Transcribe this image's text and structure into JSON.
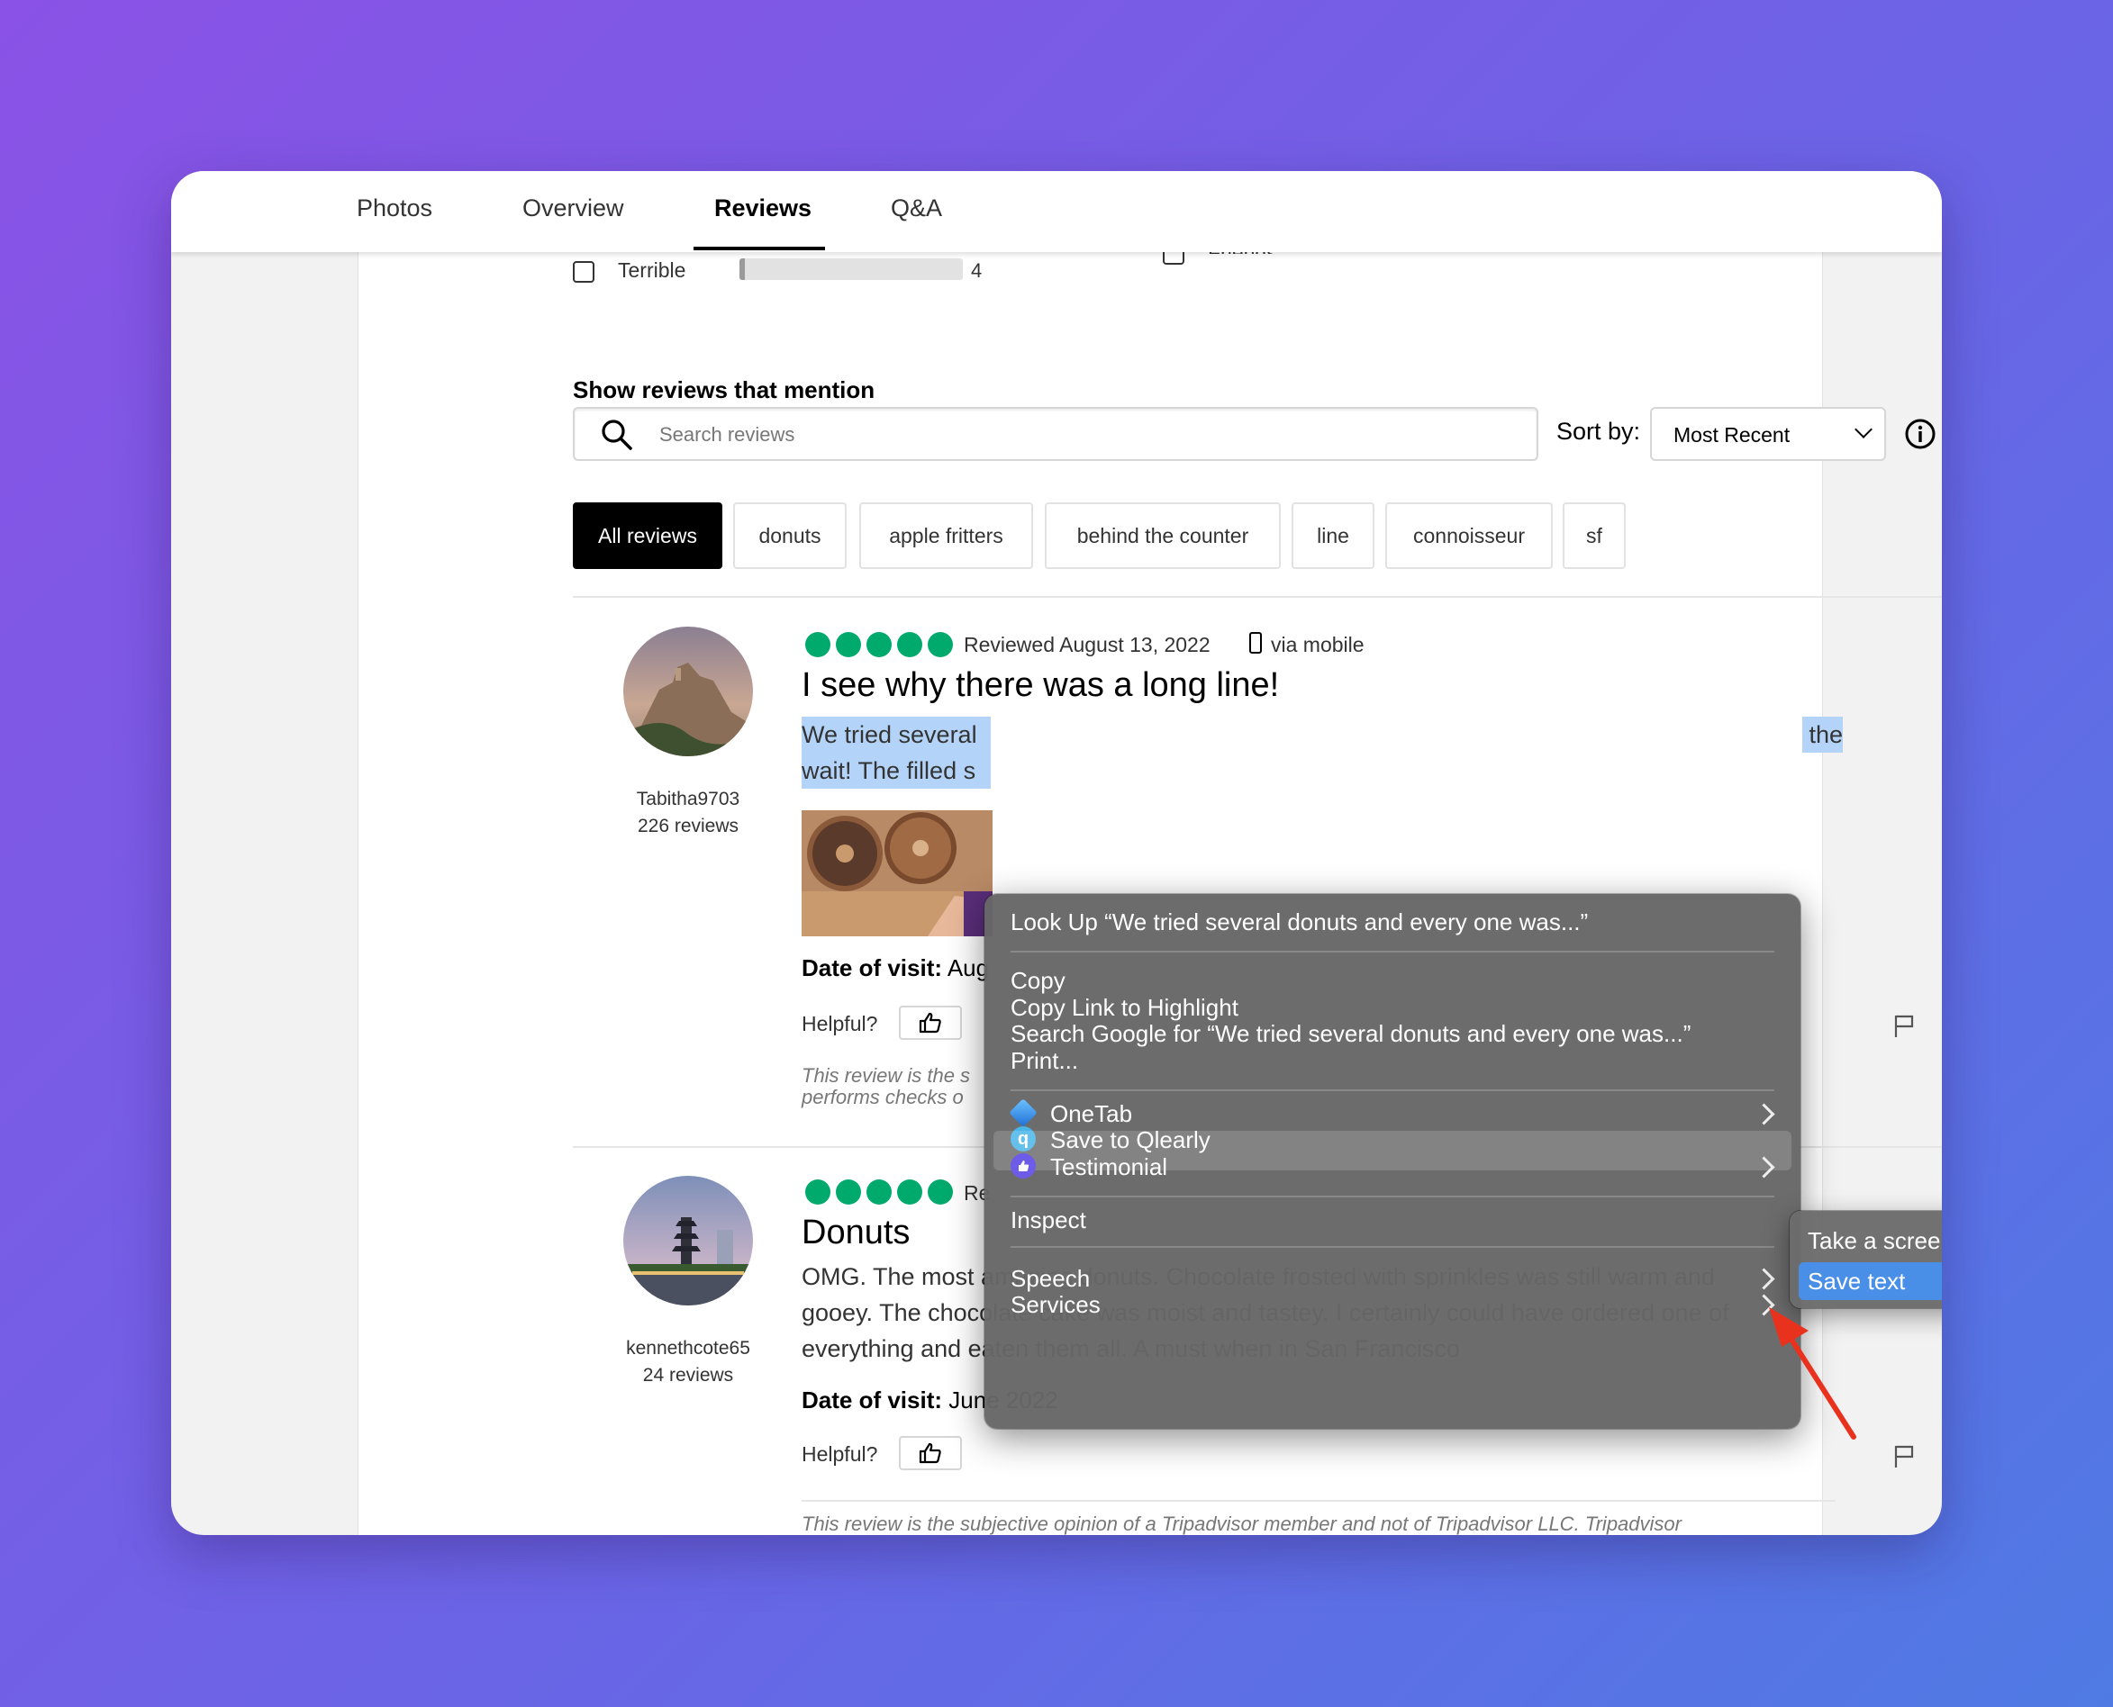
{
  "tabs": [
    "Photos",
    "Overview",
    "Reviews",
    "Q&A"
  ],
  "active_tab": "Reviews",
  "rating_filter": {
    "label": "Terrible",
    "count": "4",
    "partial_label": "Friends"
  },
  "mention": {
    "title": "Show reviews that mention",
    "search_placeholder": "Search reviews",
    "sort_label": "Sort by:",
    "sort_value": "Most Recent"
  },
  "chips": [
    "All reviews",
    "donuts",
    "apple fritters",
    "behind the counter",
    "line",
    "connoisseur",
    "sf"
  ],
  "reviews": [
    {
      "user": "Tabitha9703",
      "user_reviews": "226 reviews",
      "rating": 5,
      "date": "Reviewed August 13, 2022",
      "device": "via mobile",
      "title": "I see why there was a long line!",
      "body_line1_left": "We tried several",
      "body_line1_right": "the",
      "body_line2": "wait! The filled s",
      "visit_label": "Date of visit:",
      "visit_value": "Aug",
      "helpful": "Helpful?",
      "disclaimer_line1": "This review is the s",
      "disclaimer_line2": "performs checks o"
    },
    {
      "user": "kennethcote65",
      "user_reviews": "24 reviews",
      "rating": 5,
      "date_partial": "Re",
      "title": "Donuts",
      "body": [
        "OMG. The most amazing donuts. Chocolate frosted with sprinkles was still warm and",
        "gooey. The chocolate cake was moist and tastey. I certainly could have ordered one of",
        "everything and eaten them all. A must when in San Francisco"
      ],
      "visit_label": "Date of visit:",
      "visit_value": "June 2022",
      "helpful": "Helpful?",
      "disclaimer": "This review is the subjective opinion of a Tripadvisor member and not of Tripadvisor LLC. Tripadvisor"
    }
  ],
  "context_menu": {
    "lookup": "Look Up “We tried several donuts and every one was...”",
    "copy": "Copy",
    "copy_link": "Copy Link to Highlight",
    "search_google": "Search Google for “We tried several donuts and every one was...”",
    "print": "Print...",
    "onetab": "OneTab",
    "qlearly": "Save to Qlearly",
    "testimonial": "Testimonial",
    "inspect": "Inspect",
    "speech": "Speech",
    "services": "Services"
  },
  "submenu": {
    "screenshot": "Take a screenshot",
    "save_text": "Save text"
  },
  "colors": {
    "rating_green": "#00aa6c",
    "highlight": "#b3d4f8",
    "menu_selected": "#4a8fe7",
    "annotation_arrow": "#e8321e"
  }
}
